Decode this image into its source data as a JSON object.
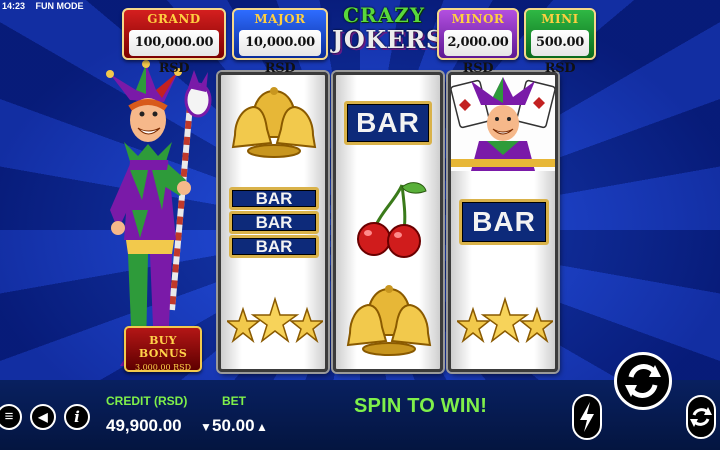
{
  "status": {
    "time": "14:23",
    "mode": "FUN MODE"
  },
  "jackpots": {
    "grand": {
      "label": "GRAND",
      "value": "100,000.00 RSD"
    },
    "major": {
      "label": "MAJOR",
      "value": "10,000.00 RSD"
    },
    "minor": {
      "label": "MINOR",
      "value": "2,000.00 RSD"
    },
    "mini": {
      "label": "MINI",
      "value": "500.00 RSD"
    }
  },
  "logo": {
    "line1": "CRAZY",
    "line2": "JOKERS"
  },
  "reels": [
    {
      "symbols": [
        "bells",
        "triple-bar",
        "stars"
      ],
      "bar_labels": [
        "BAR",
        "BAR",
        "BAR"
      ]
    },
    {
      "symbols": [
        "bar",
        "cherries",
        "bells"
      ],
      "bar_label": "BAR"
    },
    {
      "symbols": [
        "joker",
        "bar",
        "stars"
      ],
      "bar_label": "BAR"
    }
  ],
  "buy_bonus": {
    "label": "BUY BONUS",
    "price": "3,000.00 RSD"
  },
  "bottom": {
    "credit_label": "CREDIT (RSD)",
    "credit_value": "49,900.00",
    "bet_label": "BET",
    "bet_value": "50.00",
    "message": "SPIN TO WIN!"
  },
  "icons": [
    "menu-icon",
    "sound-icon",
    "info-icon",
    "bet-decrease-icon",
    "bet-increase-icon",
    "turbo-icon",
    "spin-icon",
    "autoplay-icon"
  ],
  "colors": {
    "accent_green": "#7ff04a",
    "bar_blue": "#0d2a7a",
    "gold": "#d9b24a"
  }
}
